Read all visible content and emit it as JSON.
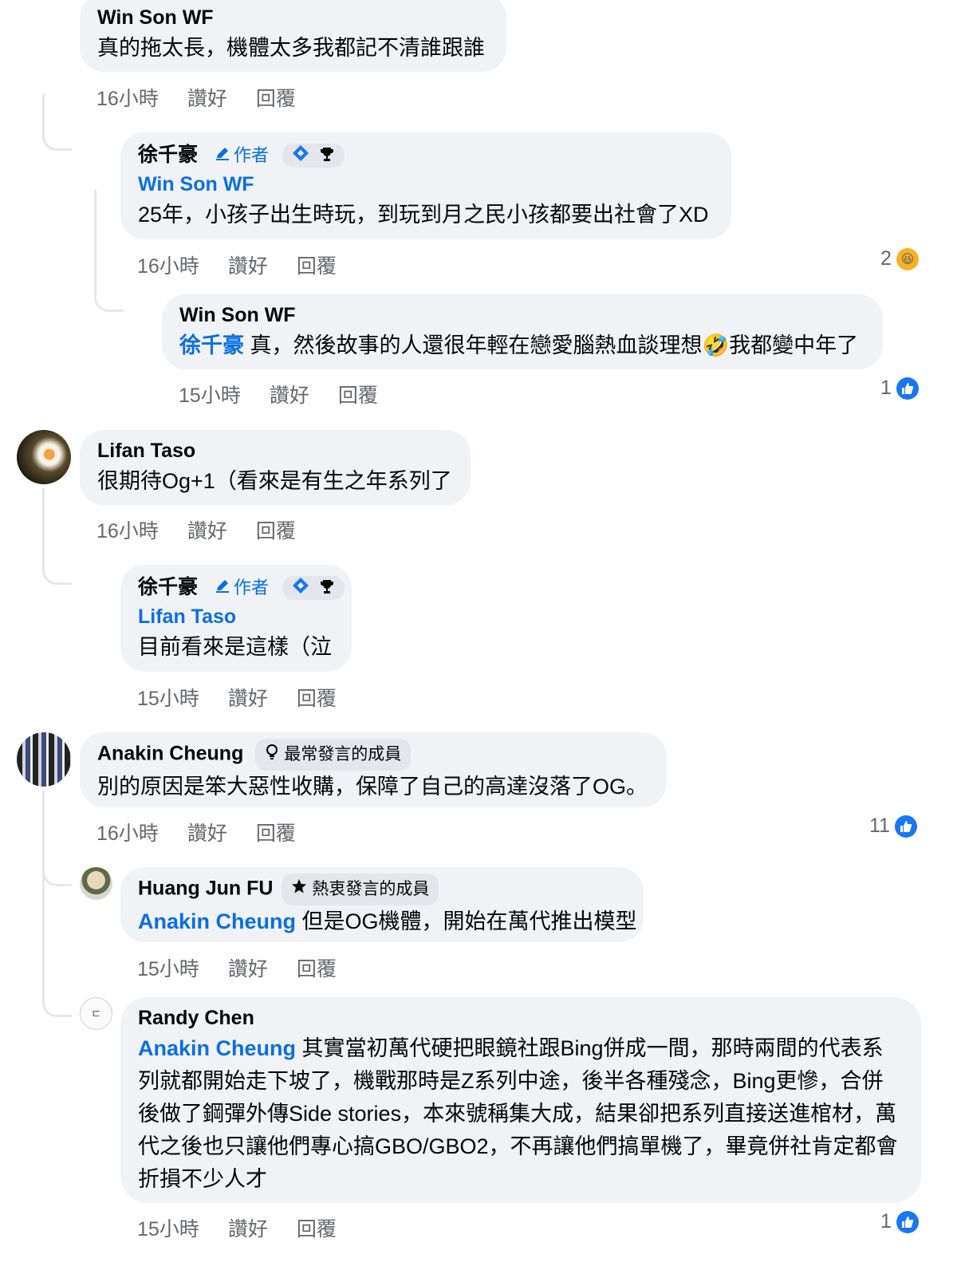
{
  "comments": [
    {
      "name": "Win Son WF",
      "text": "真的拖太長，機體太多我都記不清誰跟誰",
      "time": "16小時"
    },
    {
      "name": "徐千豪",
      "badge": "作者",
      "tag": "Win Son WF",
      "text": "25年，小孩子出生時玩，到玩到月之民小孩都要出社會了XD",
      "time": "16小時",
      "reaction_count": "2",
      "reaction_icon": "haha-emoji"
    },
    {
      "name": "Win Son WF",
      "tag": "徐千豪",
      "text_before_emoji": "真，然後故事的人還很年輕在戀愛腦熱血談理想",
      "emoji": "🤣",
      "text_after_emoji": "我都變中年了",
      "time": "15小時",
      "reaction_count": "1",
      "reaction_icon": "like-icon"
    },
    {
      "name": "Lifan Taso",
      "text": "很期待Og+1（看來是有生之年系列了",
      "time": "16小時"
    },
    {
      "name": "徐千豪",
      "badge": "作者",
      "tag": "Lifan Taso",
      "text": "目前看來是這樣（泣",
      "time": "15小時"
    },
    {
      "name": "Anakin Cheung",
      "member_badge": "最常發言的成員",
      "text": "別的原因是笨大惡性收購，保障了自己的高達沒落了OG。",
      "time": "16小時",
      "reaction_count": "11",
      "reaction_icon": "like-icon"
    },
    {
      "name": "Huang Jun FU",
      "member_badge": "熱衷發言的成員",
      "tag": "Anakin Cheung",
      "text": "但是OG機體，開始在萬代推出模型",
      "time": "15小時"
    },
    {
      "name": "Randy Chen",
      "tag": "Anakin Cheung",
      "text": "其實當初萬代硬把眼鏡社跟Bing併成一間，那時兩間的代表系列就都開始走下坡了，機戰那時是Z系列中途，後半各種殘念，Bing更慘，合併後做了鋼彈外傳Side stories，本來號稱集大成，結果卻把系列直接送進棺材，萬代之後也只讓他們專心搞GBO/GBO2，不再讓他們搞單機了，畢竟併社肯定都會折損不少人才",
      "time": "15小時",
      "reaction_count": "1",
      "reaction_icon": "like-icon"
    }
  ],
  "actions": {
    "like": "讚好",
    "reply": "回覆"
  },
  "avatar_text": {
    "randy": "ㄷ"
  },
  "colors": {
    "bubble": "#f0f2f5",
    "link": "#0a6fe0",
    "meta": "#65676b",
    "like": "#1877f2"
  }
}
